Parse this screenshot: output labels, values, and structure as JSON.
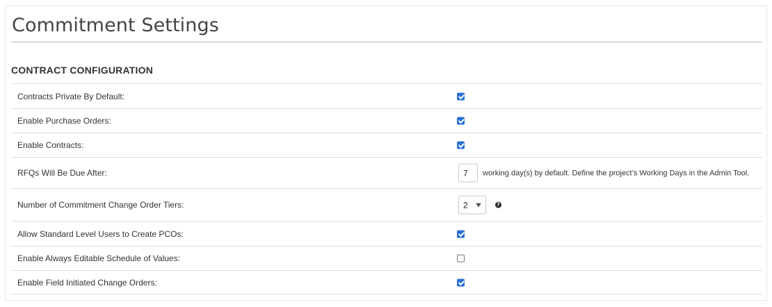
{
  "page": {
    "title": "Commitment Settings"
  },
  "section": {
    "heading": "CONTRACT CONFIGURATION"
  },
  "settings": [
    {
      "label": "Contracts Private By Default:",
      "control": "checkbox",
      "checked": true
    },
    {
      "label": "Enable Purchase Orders:",
      "control": "checkbox",
      "checked": true
    },
    {
      "label": "Enable Contracts:",
      "control": "checkbox",
      "checked": true
    },
    {
      "label": "RFQs Will Be Due After:",
      "control": "number",
      "value": "7",
      "suffix": "working day(s) by default. Define the project’s Working Days in the Admin Tool."
    },
    {
      "label": "Number of Commitment Change Order Tiers:",
      "control": "select",
      "value": "2",
      "help_icon": "question-circle-icon"
    },
    {
      "label": "Allow Standard Level Users to Create PCOs:",
      "control": "checkbox",
      "checked": true
    },
    {
      "label": "Enable Always Editable Schedule of Values:",
      "control": "checkbox",
      "checked": false
    },
    {
      "label": "Enable Field Initiated Change Orders:",
      "control": "checkbox",
      "checked": true
    }
  ],
  "colors": {
    "checkbox_checked": "#2a6fd6",
    "rule": "#dcdcdc"
  }
}
